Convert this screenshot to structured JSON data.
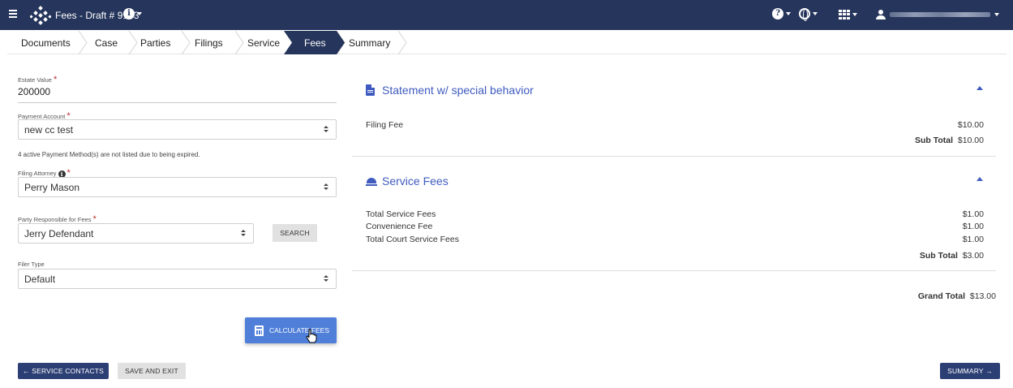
{
  "header": {
    "title": "Fees - Draft # 9103",
    "icons": [
      "menu-icon",
      "logo-icon",
      "info-icon",
      "help-icon",
      "globe-icon",
      "apps-grid-icon",
      "user-icon"
    ]
  },
  "steps": [
    "Documents",
    "Case",
    "Parties",
    "Filings",
    "Service",
    "Fees",
    "Summary"
  ],
  "active_step": "Fees",
  "form": {
    "estate_value_label": "Estate Value",
    "estate_value": "200000",
    "payment_account_label": "Payment Account",
    "payment_account_value": "new cc test",
    "expired_note": "4 active Payment Method(s) are not listed due to being expired.",
    "filing_attorney_label": "Filing Attorney",
    "filing_attorney_value": "Perry Mason",
    "party_responsible_label": "Party Responsible for Fees",
    "party_responsible_value": "Jerry Defendant",
    "search_label": "SEARCH",
    "filer_type_label": "Filer Type",
    "filer_type_value": "Default",
    "calculate_label": "CALCULATE FEES",
    "required_mark": "*"
  },
  "footer": {
    "back_label": "← SERVICE CONTACTS",
    "save_exit_label": "SAVE AND EXIT",
    "next_label": "SUMMARY →"
  },
  "fees": {
    "statement": {
      "title": "Statement w/ special behavior",
      "rows": [
        {
          "label": "Filing Fee",
          "value": "$10.00"
        }
      ],
      "subtotal_label": "Sub Total",
      "subtotal_value": "$10.00"
    },
    "service": {
      "title": "Service Fees",
      "rows": [
        {
          "label": "Total Service Fees",
          "value": "$1.00"
        },
        {
          "label": "Convenience Fee",
          "value": "$1.00"
        },
        {
          "label": "Total Court Service Fees",
          "value": "$1.00"
        }
      ],
      "subtotal_label": "Sub Total",
      "subtotal_value": "$3.00"
    },
    "grand_total_label": "Grand Total",
    "grand_total_value": "$13.00"
  },
  "colors": {
    "topbar": "#26355c",
    "accent": "#3f5bbf",
    "calc_button": "#4f7fd9",
    "required": "#c0272d"
  }
}
